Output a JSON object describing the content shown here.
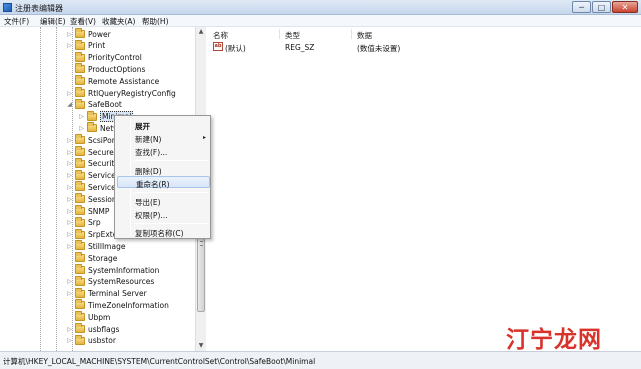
{
  "window": {
    "title": "注册表编辑器",
    "buttons": {
      "minimize": "─",
      "maximize": "□",
      "close": "✕"
    }
  },
  "menu": [
    "文件(F)",
    "编辑(E)",
    "查看(V)",
    "收藏夹(A)",
    "帮助(H)"
  ],
  "tree": {
    "items": [
      {
        "label": "Power",
        "arrow": "▷"
      },
      {
        "label": "Print",
        "arrow": "▷"
      },
      {
        "label": "PriorityControl",
        "arrow": ""
      },
      {
        "label": "ProductOptions",
        "arrow": ""
      },
      {
        "label": "Remote Assistance",
        "arrow": ""
      },
      {
        "label": "RtlQueryRegistryConfig",
        "arrow": "▷"
      },
      {
        "label": "SafeBoot",
        "arrow": "◢"
      },
      {
        "label": "Minimal",
        "arrow": "▷"
      },
      {
        "label": "Netw",
        "arrow": "▷"
      },
      {
        "label": "ScsiPor",
        "arrow": "▷"
      },
      {
        "label": "SecureP",
        "arrow": "▷"
      },
      {
        "label": "Security",
        "arrow": "▷"
      },
      {
        "label": "Service",
        "arrow": "▷"
      },
      {
        "label": "Service",
        "arrow": "▷"
      },
      {
        "label": "Session",
        "arrow": "▷"
      },
      {
        "label": "SNMP",
        "arrow": "▷"
      },
      {
        "label": "Srp",
        "arrow": "▷"
      },
      {
        "label": "SrpExte",
        "arrow": "▷"
      },
      {
        "label": "StillImage",
        "arrow": "▷"
      },
      {
        "label": "Storage",
        "arrow": ""
      },
      {
        "label": "SystemInformation",
        "arrow": ""
      },
      {
        "label": "SystemResources",
        "arrow": "▷"
      },
      {
        "label": "Terminal Server",
        "arrow": "▷"
      },
      {
        "label": "TimeZoneInformation",
        "arrow": ""
      },
      {
        "label": "Ubpm",
        "arrow": ""
      },
      {
        "label": "usbflags",
        "arrow": "▷"
      },
      {
        "label": "usbstor",
        "arrow": "▷"
      }
    ],
    "scroll": {
      "up": "▲",
      "down": "▼"
    }
  },
  "values": {
    "columns": [
      "名称",
      "类型",
      "数据"
    ],
    "rows": [
      {
        "icon": "ab",
        "name": "(默认)",
        "type": "REG_SZ",
        "data": "(数值未设置)"
      }
    ]
  },
  "context_menu": {
    "items": [
      {
        "label": "展开"
      },
      {
        "label": "新建(N)",
        "submenu": "▸"
      },
      {
        "label": "查找(F)..."
      },
      {
        "label": "删除(D)"
      },
      {
        "label": "重命名(R)"
      },
      {
        "label": "导出(E)"
      },
      {
        "label": "权限(P)..."
      },
      {
        "label": "复制项名称(C)"
      }
    ]
  },
  "status": {
    "path": "计算机\\HKEY_LOCAL_MACHINE\\SYSTEM\\CurrentControlSet\\Control\\SafeBoot\\Minimal"
  },
  "watermark": {
    "text": "汀宁龙网"
  }
}
